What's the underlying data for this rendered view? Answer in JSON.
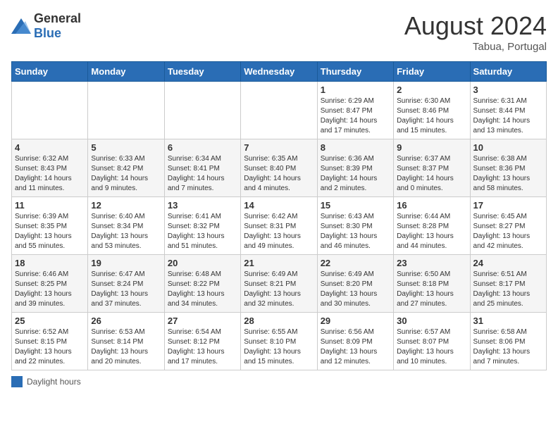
{
  "logo": {
    "general": "General",
    "blue": "Blue"
  },
  "header": {
    "month": "August 2024",
    "location": "Tabua, Portugal"
  },
  "days_of_week": [
    "Sunday",
    "Monday",
    "Tuesday",
    "Wednesday",
    "Thursday",
    "Friday",
    "Saturday"
  ],
  "legend": {
    "label": "Daylight hours"
  },
  "weeks": [
    [
      {
        "day": "",
        "info": ""
      },
      {
        "day": "",
        "info": ""
      },
      {
        "day": "",
        "info": ""
      },
      {
        "day": "",
        "info": ""
      },
      {
        "day": "1",
        "info": "Sunrise: 6:29 AM\nSunset: 8:47 PM\nDaylight: 14 hours and 17 minutes."
      },
      {
        "day": "2",
        "info": "Sunrise: 6:30 AM\nSunset: 8:46 PM\nDaylight: 14 hours and 15 minutes."
      },
      {
        "day": "3",
        "info": "Sunrise: 6:31 AM\nSunset: 8:44 PM\nDaylight: 14 hours and 13 minutes."
      }
    ],
    [
      {
        "day": "4",
        "info": "Sunrise: 6:32 AM\nSunset: 8:43 PM\nDaylight: 14 hours and 11 minutes."
      },
      {
        "day": "5",
        "info": "Sunrise: 6:33 AM\nSunset: 8:42 PM\nDaylight: 14 hours and 9 minutes."
      },
      {
        "day": "6",
        "info": "Sunrise: 6:34 AM\nSunset: 8:41 PM\nDaylight: 14 hours and 7 minutes."
      },
      {
        "day": "7",
        "info": "Sunrise: 6:35 AM\nSunset: 8:40 PM\nDaylight: 14 hours and 4 minutes."
      },
      {
        "day": "8",
        "info": "Sunrise: 6:36 AM\nSunset: 8:39 PM\nDaylight: 14 hours and 2 minutes."
      },
      {
        "day": "9",
        "info": "Sunrise: 6:37 AM\nSunset: 8:37 PM\nDaylight: 14 hours and 0 minutes."
      },
      {
        "day": "10",
        "info": "Sunrise: 6:38 AM\nSunset: 8:36 PM\nDaylight: 13 hours and 58 minutes."
      }
    ],
    [
      {
        "day": "11",
        "info": "Sunrise: 6:39 AM\nSunset: 8:35 PM\nDaylight: 13 hours and 55 minutes."
      },
      {
        "day": "12",
        "info": "Sunrise: 6:40 AM\nSunset: 8:34 PM\nDaylight: 13 hours and 53 minutes."
      },
      {
        "day": "13",
        "info": "Sunrise: 6:41 AM\nSunset: 8:32 PM\nDaylight: 13 hours and 51 minutes."
      },
      {
        "day": "14",
        "info": "Sunrise: 6:42 AM\nSunset: 8:31 PM\nDaylight: 13 hours and 49 minutes."
      },
      {
        "day": "15",
        "info": "Sunrise: 6:43 AM\nSunset: 8:30 PM\nDaylight: 13 hours and 46 minutes."
      },
      {
        "day": "16",
        "info": "Sunrise: 6:44 AM\nSunset: 8:28 PM\nDaylight: 13 hours and 44 minutes."
      },
      {
        "day": "17",
        "info": "Sunrise: 6:45 AM\nSunset: 8:27 PM\nDaylight: 13 hours and 42 minutes."
      }
    ],
    [
      {
        "day": "18",
        "info": "Sunrise: 6:46 AM\nSunset: 8:25 PM\nDaylight: 13 hours and 39 minutes."
      },
      {
        "day": "19",
        "info": "Sunrise: 6:47 AM\nSunset: 8:24 PM\nDaylight: 13 hours and 37 minutes."
      },
      {
        "day": "20",
        "info": "Sunrise: 6:48 AM\nSunset: 8:22 PM\nDaylight: 13 hours and 34 minutes."
      },
      {
        "day": "21",
        "info": "Sunrise: 6:49 AM\nSunset: 8:21 PM\nDaylight: 13 hours and 32 minutes."
      },
      {
        "day": "22",
        "info": "Sunrise: 6:49 AM\nSunset: 8:20 PM\nDaylight: 13 hours and 30 minutes."
      },
      {
        "day": "23",
        "info": "Sunrise: 6:50 AM\nSunset: 8:18 PM\nDaylight: 13 hours and 27 minutes."
      },
      {
        "day": "24",
        "info": "Sunrise: 6:51 AM\nSunset: 8:17 PM\nDaylight: 13 hours and 25 minutes."
      }
    ],
    [
      {
        "day": "25",
        "info": "Sunrise: 6:52 AM\nSunset: 8:15 PM\nDaylight: 13 hours and 22 minutes."
      },
      {
        "day": "26",
        "info": "Sunrise: 6:53 AM\nSunset: 8:14 PM\nDaylight: 13 hours and 20 minutes."
      },
      {
        "day": "27",
        "info": "Sunrise: 6:54 AM\nSunset: 8:12 PM\nDaylight: 13 hours and 17 minutes."
      },
      {
        "day": "28",
        "info": "Sunrise: 6:55 AM\nSunset: 8:10 PM\nDaylight: 13 hours and 15 minutes."
      },
      {
        "day": "29",
        "info": "Sunrise: 6:56 AM\nSunset: 8:09 PM\nDaylight: 13 hours and 12 minutes."
      },
      {
        "day": "30",
        "info": "Sunrise: 6:57 AM\nSunset: 8:07 PM\nDaylight: 13 hours and 10 minutes."
      },
      {
        "day": "31",
        "info": "Sunrise: 6:58 AM\nSunset: 8:06 PM\nDaylight: 13 hours and 7 minutes."
      }
    ]
  ]
}
